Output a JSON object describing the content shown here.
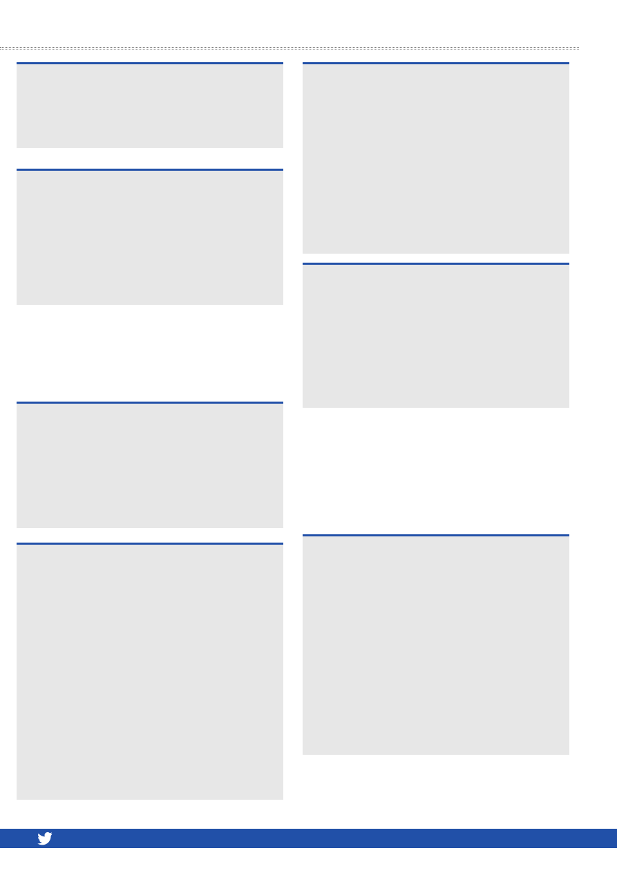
{
  "page": {
    "accent_color": "#2150a8",
    "panel_color": "#e7e7e7",
    "rule_color": "#6b6b6b"
  },
  "footer": {
    "bar_color": "#2150a8",
    "social_icon": "twitter-bird-icon",
    "icon_color": "#ffffff"
  }
}
